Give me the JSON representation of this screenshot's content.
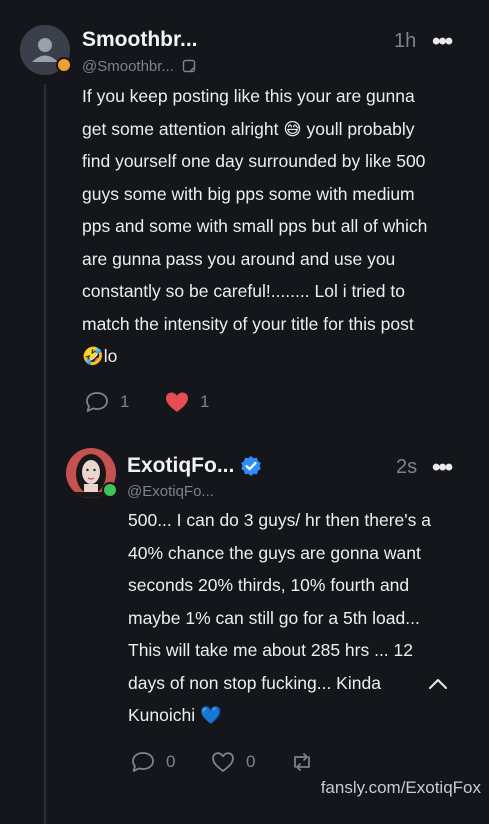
{
  "post1": {
    "display_name": "Smoothbr...",
    "handle": "@Smoothbr...",
    "time": "1h",
    "more": "•••",
    "text_lines": [
      "If you keep posting like this your are gunna",
      "get some attention alright 😅 youll probably",
      "find yourself one day surrounded by like 500",
      "guys some with big pps some with medium",
      "pps and some with small pps but all of which",
      "are gunna pass you around and use you",
      "constantly so be careful!........ Lol i tried to",
      "match the intensity of your title for this post",
      "🤣lo"
    ],
    "reply_count": "1",
    "like_count": "1",
    "colors": {
      "online_dot": "#f0a030",
      "heart": "#e54d54"
    }
  },
  "post2": {
    "display_name": "ExotiqFo...",
    "handle": "@ExotiqFo...",
    "time": "2s",
    "more": "•••",
    "text_lines": [
      "500... I can do 3 guys/ hr then there's a",
      "40% chance the guys are gonna want",
      "seconds 20% thirds, 10% fourth and",
      "maybe 1% can still go for a 5th load...",
      "This will take me about 285 hrs ... 12",
      "days of non stop fucking... Kinda",
      "Kunoichi 💙"
    ],
    "reply_count": "0",
    "like_count": "0",
    "colors": {
      "online_dot": "#3ec25a",
      "verified": "#2f8ff7"
    }
  },
  "watermark": "fansly.com/ExotiqFox"
}
